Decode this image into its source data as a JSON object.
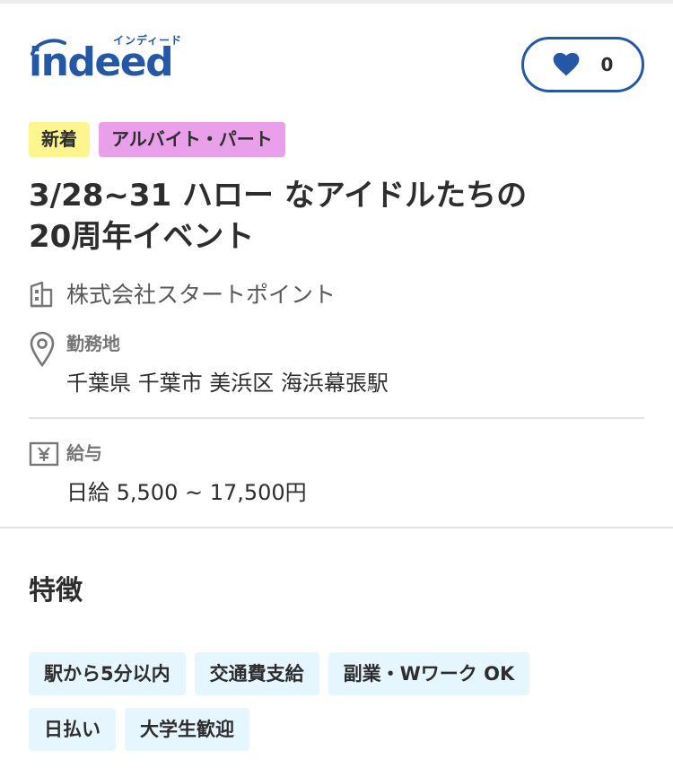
{
  "header": {
    "logo_text": "indeed",
    "logo_kana": "インディード",
    "favorite_count": "0"
  },
  "badges": [
    {
      "label": "新着",
      "color": "#fff58f"
    },
    {
      "label": "アルバイト・パート",
      "color": "#ea9fea"
    }
  ],
  "job": {
    "title_line1": "3/28~31 ハロー なアイドルたちの",
    "title_line2": "20周年イベント",
    "company": "株式会社スタートポイント",
    "location_label": "勤務地",
    "location": "千葉県 千葉市 美浜区 海浜幕張駅",
    "salary_label": "給与",
    "salary": "日給 5,500 ~ 17,500円"
  },
  "features": {
    "title": "特徴",
    "chips": [
      "駅から5分以内",
      "交通費支給",
      "副業・Wワーク OK",
      "日払い",
      "大学生歓迎"
    ]
  },
  "icons": {
    "heart": "heart-icon",
    "building": "building-icon",
    "pin": "location-pin-icon",
    "yen": "yen-icon"
  },
  "colors": {
    "brand": "#2557a7",
    "chip_bg": "#e6f6fe"
  }
}
